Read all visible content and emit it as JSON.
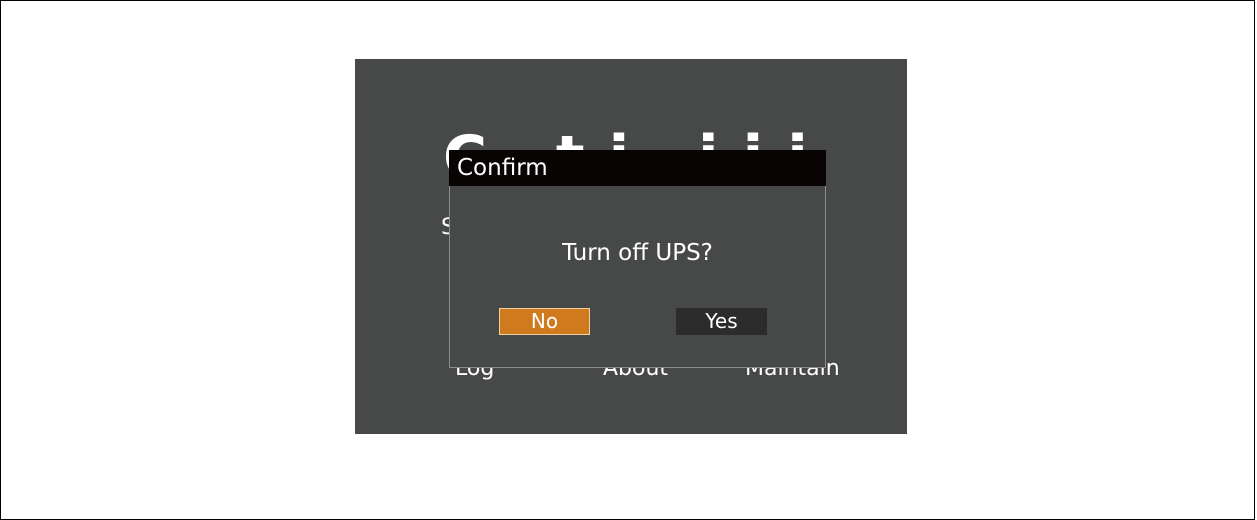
{
  "background_screen": {
    "title_partial": "C    ti     iii",
    "items": {
      "s_partial": "S",
      "log": "Log",
      "about": "About",
      "maintain": "Maintain"
    }
  },
  "dialog": {
    "title": "Confirm",
    "message": "Turn off UPS?",
    "no_label": "No",
    "yes_label": "Yes",
    "selected": "No"
  },
  "colors": {
    "screen_bg": "#474948",
    "header_bg": "#080404",
    "selected_button": "#d07a1e",
    "unselected_button": "#2c2c2c",
    "text": "#ffffff"
  }
}
